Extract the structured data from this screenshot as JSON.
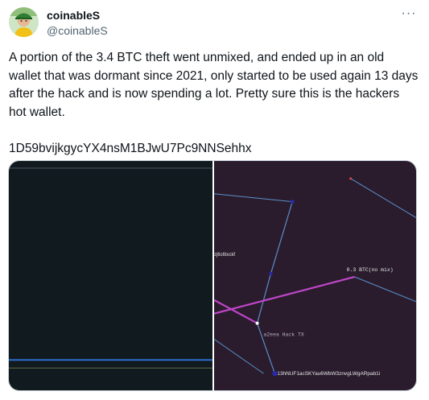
{
  "author": {
    "display_name": "coinableS",
    "handle": "@coinableS",
    "avatar_icon": "avatar-icon"
  },
  "more_menu": {
    "label": "···"
  },
  "tweet": {
    "text": "A portion of the 3.4 BTC theft went unmixed, and ended up in an old wallet that was dormant since 2021, only started to be used again 13 days after the hack and is now spending a lot. Pretty sure this is the hackers hot wallet.\n\n1D59bvijkgycYX4nsM1BJwU7Pc9NNSehhx"
  },
  "graph": {
    "labels": {
      "partial_address": "zj6c6txckf",
      "unmixed_amount": "0.3 BTC(no mix)",
      "hack_tx": "a2eea Hack TX",
      "wallet_address": "13hNUF1acSKYau6WbW3znvgLWgARpab1i"
    },
    "colors": {
      "left_bg": "#111a1f",
      "right_bg": "#2a1c2d",
      "edge_blue": "#5b8fc9",
      "edge_magenta": "#c046c9",
      "node_blue": "#2a2aa8"
    }
  }
}
